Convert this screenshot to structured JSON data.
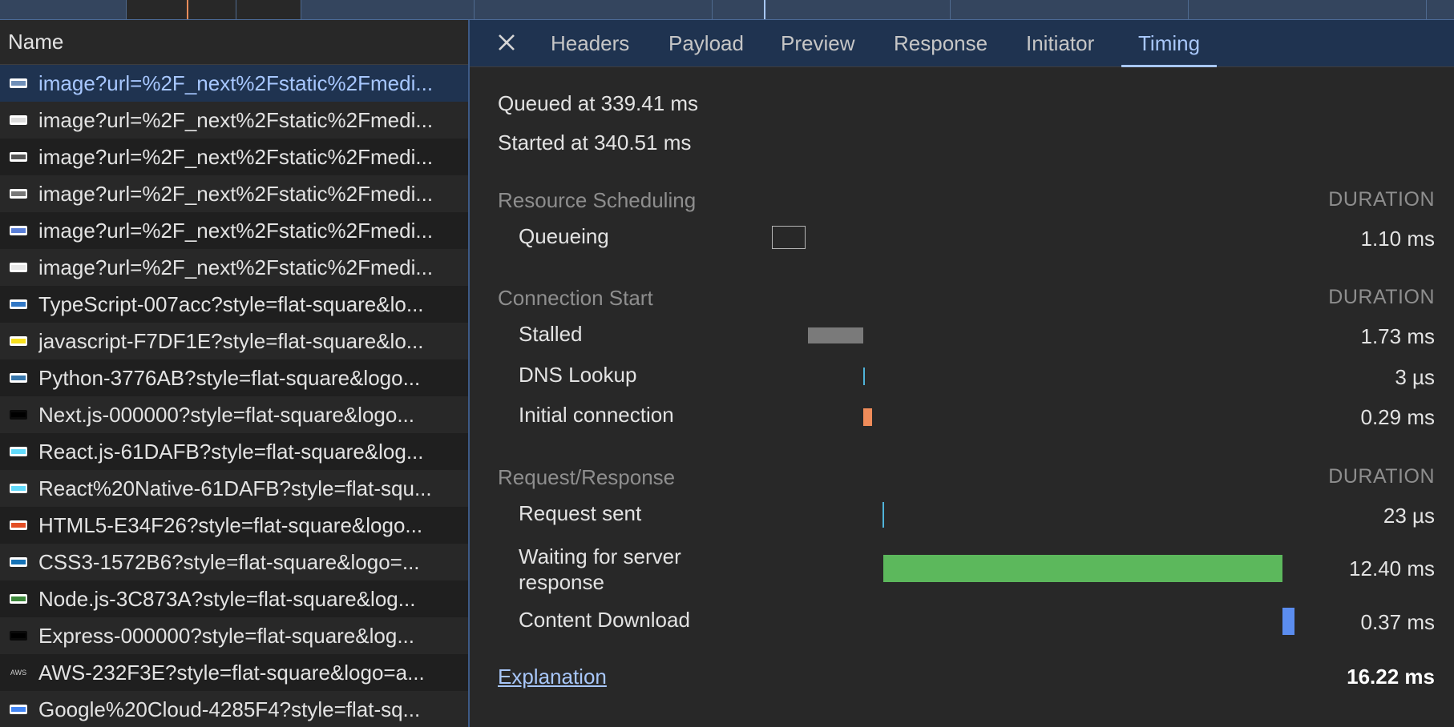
{
  "list_header": "Name",
  "requests": [
    {
      "name": "image?url=%2F_next%2Fstatic%2Fmedi...",
      "thumb_color": "#6f8fb8",
      "selected": true
    },
    {
      "name": "image?url=%2F_next%2Fstatic%2Fmedi...",
      "thumb_color": "#dddddd"
    },
    {
      "name": "image?url=%2F_next%2Fstatic%2Fmedi...",
      "thumb_color": "#555555"
    },
    {
      "name": "image?url=%2F_next%2Fstatic%2Fmedi...",
      "thumb_color": "#777777"
    },
    {
      "name": "image?url=%2F_next%2Fstatic%2Fmedi...",
      "thumb_color": "#5a7fd8"
    },
    {
      "name": "image?url=%2F_next%2Fstatic%2Fmedi...",
      "thumb_color": "#e8e8e8"
    },
    {
      "name": "TypeScript-007acc?style=flat-square&lo...",
      "thumb_color": "#3178c6"
    },
    {
      "name": "javascript-F7DF1E?style=flat-square&lo...",
      "thumb_color": "#f7df1e"
    },
    {
      "name": "Python-3776AB?style=flat-square&logo...",
      "thumb_color": "#3776ab"
    },
    {
      "name": "Next.js-000000?style=flat-square&logo...",
      "thumb_color": "#000000"
    },
    {
      "name": "React.js-61DAFB?style=flat-square&log...",
      "thumb_color": "#61dafb"
    },
    {
      "name": "React%20Native-61DAFB?style=flat-squ...",
      "thumb_color": "#61dafb"
    },
    {
      "name": "HTML5-E34F26?style=flat-square&logo...",
      "thumb_color": "#e34f26"
    },
    {
      "name": "CSS3-1572B6?style=flat-square&logo=...",
      "thumb_color": "#1572b6"
    },
    {
      "name": "Node.js-3C873A?style=flat-square&log...",
      "thumb_color": "#3c873a"
    },
    {
      "name": "Express-000000?style=flat-square&log...",
      "thumb_color": "#000000"
    },
    {
      "name": "AWS-232F3E?style=flat-square&logo=a...",
      "thumb_color": "#232f3e",
      "thumb_text": "AWS"
    },
    {
      "name": "Google%20Cloud-4285F4?style=flat-sq...",
      "thumb_color": "#4285f4"
    }
  ],
  "close_icon": "close-icon",
  "tabs": [
    "Headers",
    "Payload",
    "Preview",
    "Response",
    "Initiator",
    "Timing"
  ],
  "active_tab": "Timing",
  "queued_at": "Queued at 339.41 ms",
  "started_at": "Started at 340.51 ms",
  "duration_label": "DURATION",
  "sections": [
    {
      "title": "Resource Scheduling",
      "phases": [
        {
          "label": "Queueing",
          "value": "1.10 ms"
        }
      ]
    },
    {
      "title": "Connection Start",
      "phases": [
        {
          "label": "Stalled",
          "value": "1.73 ms"
        },
        {
          "label": "DNS Lookup",
          "value": "3 µs"
        },
        {
          "label": "Initial connection",
          "value": "0.29 ms"
        }
      ]
    },
    {
      "title": "Request/Response",
      "phases": [
        {
          "label": "Request sent",
          "value": "23 µs"
        },
        {
          "label": "Waiting for server response",
          "value": "12.40 ms"
        },
        {
          "label": "Content Download",
          "value": "0.37 ms"
        }
      ]
    }
  ],
  "explanation_link": "Explanation",
  "total": "16.22 ms",
  "colors": {
    "queueing": "#282828",
    "stalled": "#7a7a7a",
    "dns": "#4fb3d9",
    "initial_connection": "#f08c5a",
    "request_sent": "#4fb3d9",
    "waiting": "#5cb85c",
    "content_download": "#5b8def",
    "accent": "#a8c7fa"
  }
}
